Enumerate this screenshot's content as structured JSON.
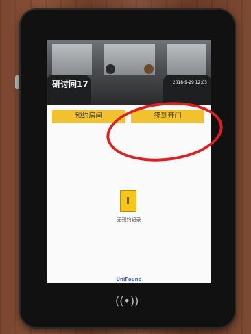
{
  "header": {
    "room": "研讨间17",
    "datetime": "2018-9-29 12:03"
  },
  "tabs": [
    {
      "label": "预约房间"
    },
    {
      "label": "签到开门"
    }
  ],
  "empty_state": {
    "text": "无预约记录"
  },
  "brand": "UniFound",
  "nfc_symbol": "((•))"
}
